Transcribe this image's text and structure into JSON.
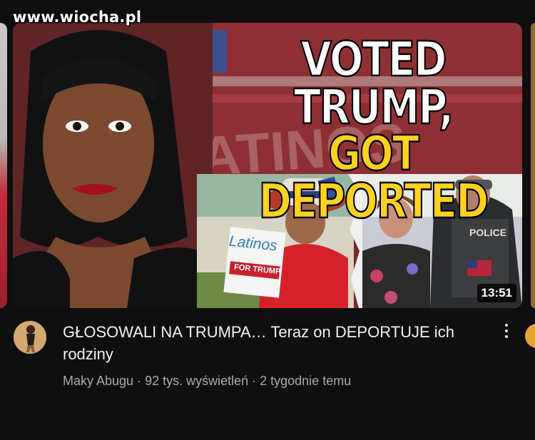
{
  "watermark": "www.wiocha.pl",
  "video": {
    "thumbnail": {
      "headline_line1": "VOTED TRUMP,",
      "headline_line2": "GOT DEPORTED",
      "bg_text": "LATINOS",
      "sign_line1": "Latinos",
      "sign_line2": "FOR TRUMP",
      "vest_text": "POLICE",
      "duration": "13:51"
    },
    "title": "GŁOSOWALI NA TRUMPA… Teraz on DEPORTUJE ich rodziny",
    "channel": "Maky Abugu",
    "views": "92 tys. wyświetleń",
    "age": "2 tygodnie temu",
    "separator": " · ",
    "menu_icon": "more-vert-icon"
  },
  "colors": {
    "background": "#0f0f0f",
    "title": "#f1f1f1",
    "meta": "#aaaaaa",
    "headline_yellow": "#ffd21f",
    "sign_blue": "#2e7fb8",
    "sign_red": "#c8222e"
  }
}
